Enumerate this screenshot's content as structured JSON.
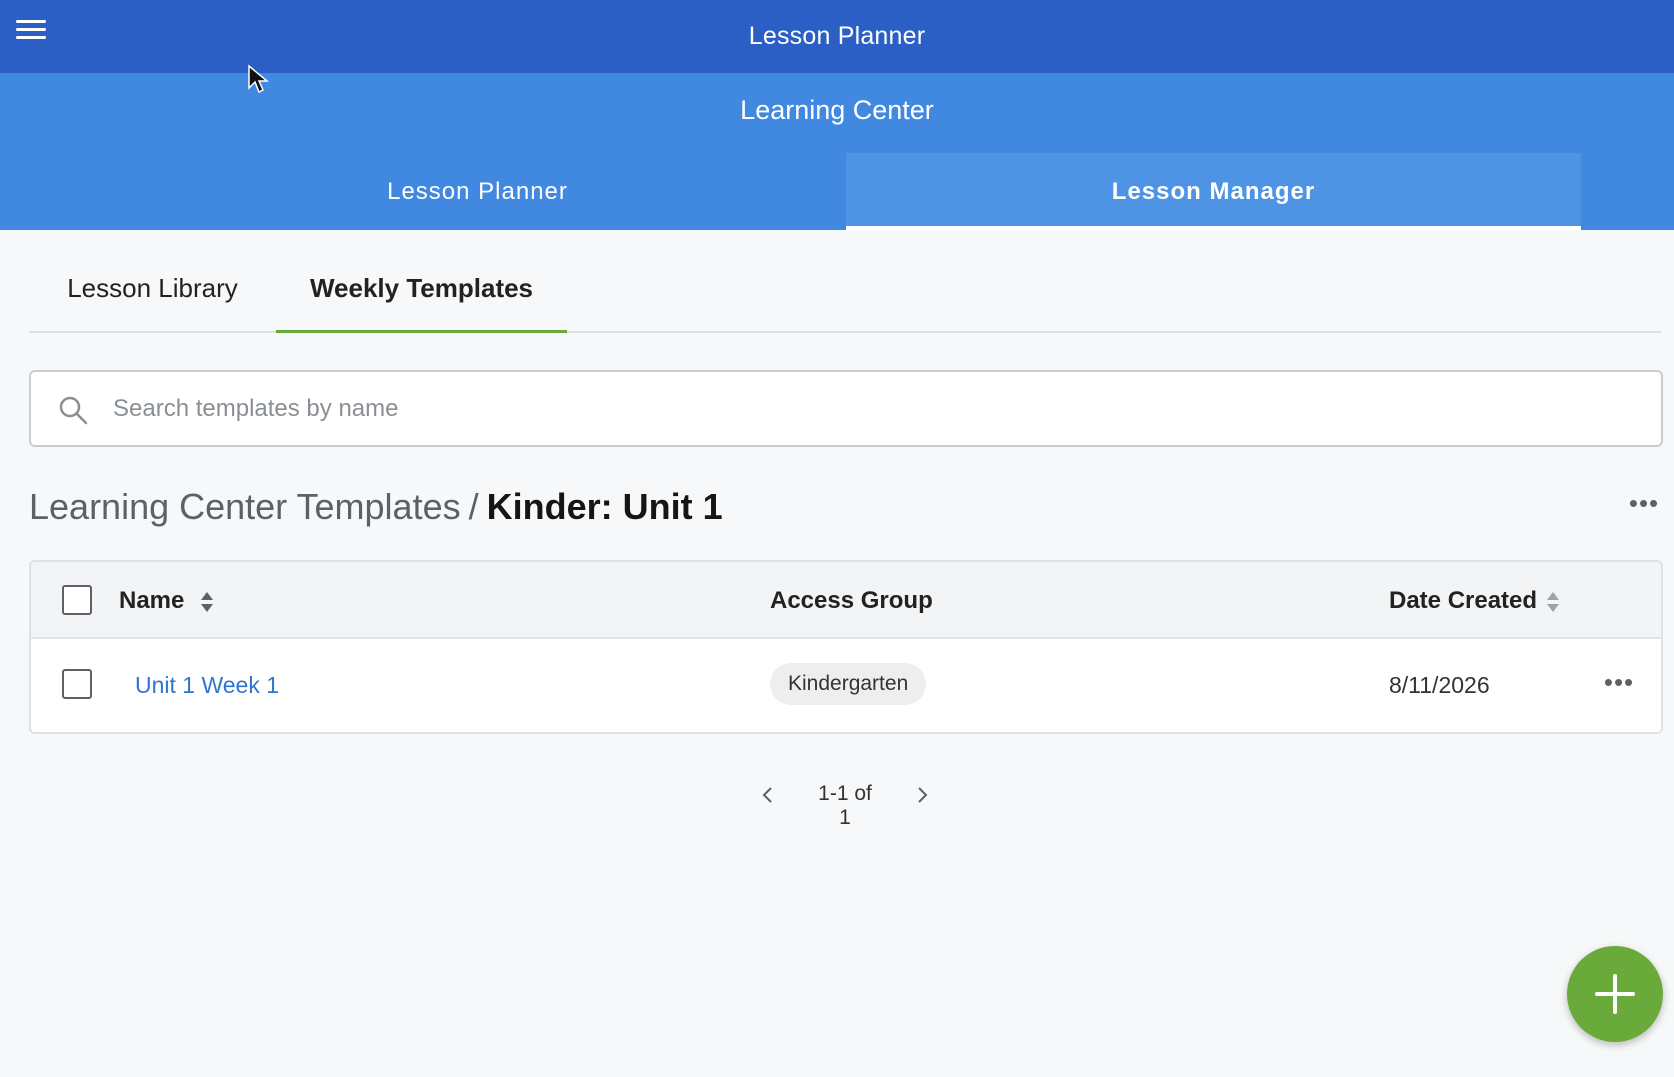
{
  "topbar": {
    "title": "Lesson Planner",
    "menu_icon": "hamburger-menu-icon",
    "color": "#2b5fc6"
  },
  "subheader": {
    "title": "Learning Center",
    "color": "#4189e0",
    "tabs": [
      {
        "label": "Lesson Planner",
        "active": false
      },
      {
        "label": "Lesson Manager",
        "active": true
      }
    ]
  },
  "sub_tabs": [
    {
      "label": "Lesson Library",
      "active": false
    },
    {
      "label": "Weekly Templates",
      "active": true
    }
  ],
  "search": {
    "placeholder": "Search templates by name",
    "value": ""
  },
  "breadcrumb": {
    "parent": "Learning Center Templates",
    "separator": "/",
    "current": "Kinder: Unit 1"
  },
  "table": {
    "columns": {
      "name": "Name",
      "access_group": "Access Group",
      "date_created": "Date Created"
    },
    "rows": [
      {
        "name": "Unit 1 Week 1",
        "access_group": "Kindergarten",
        "date_created": "8/11/2026",
        "checked": false
      }
    ]
  },
  "pagination": {
    "text": "1-1 of 1"
  },
  "fab": {
    "icon": "plus-icon",
    "color": "#6aaa3a"
  },
  "accent_colors": {
    "active_subtab_underline": "#6aaa3a",
    "link": "#2f76d2"
  }
}
